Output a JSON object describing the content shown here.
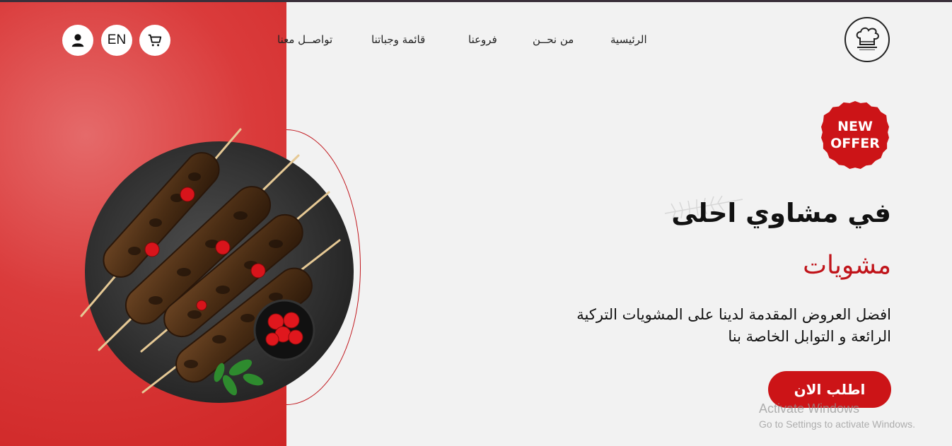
{
  "nav": {
    "home": "الرئيسية",
    "about": "من نحــن",
    "branches": "فروعنا",
    "menu": "قائمة وجباتنا",
    "contact": "تواصــل معنا"
  },
  "header": {
    "language": "EN",
    "logo_icon": "chef-hat-logo",
    "cart_icon": "cart-icon",
    "user_icon": "user-icon"
  },
  "hero": {
    "badge_line1": "NEW",
    "badge_line2": "OFFER",
    "headline": "في مشاوي احلى",
    "subhead": "مشويات",
    "description_line1": "افضل العروض المقدمة لدينا على المشويات التركية",
    "description_line2": "الرائعة و التوابل الخاصة بنا",
    "cta_label": "اطلب الان"
  },
  "overlay": {
    "activate_title": "Activate Windows",
    "activate_sub": "Go to Settings to activate Windows."
  },
  "colors": {
    "accent": "#cc1417",
    "panel": "#da3b3b",
    "background": "#f2f2f2"
  }
}
